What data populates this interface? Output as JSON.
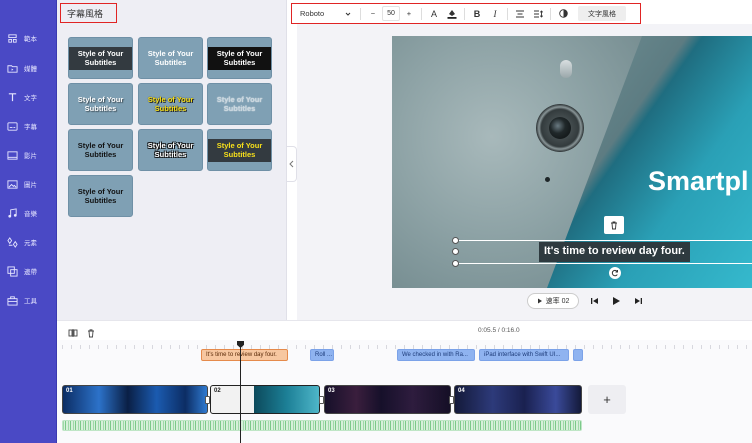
{
  "sidebar": {
    "items": [
      {
        "label": "範本",
        "icon": "template-icon"
      },
      {
        "label": "媒體",
        "icon": "media-icon"
      },
      {
        "label": "文字",
        "icon": "text-icon"
      },
      {
        "label": "字幕",
        "icon": "subtitle-icon"
      },
      {
        "label": "影片",
        "icon": "video-icon"
      },
      {
        "label": "圖片",
        "icon": "image-icon"
      },
      {
        "label": "音樂",
        "icon": "music-icon"
      },
      {
        "label": "元素",
        "icon": "elements-icon"
      },
      {
        "label": "邊帶",
        "icon": "overlay-icon"
      },
      {
        "label": "工具",
        "icon": "tools-icon"
      }
    ],
    "color": "#4a49c5"
  },
  "panel": {
    "title": "字幕風格",
    "styles": [
      {
        "text": "Style of Your Subtitles",
        "variant": "dark-box"
      },
      {
        "text": "Style of Your Subtitles",
        "variant": "plain"
      },
      {
        "text": "Style of Your Subtitles",
        "variant": "black-box"
      },
      {
        "text": "Style of Your Subtitles",
        "variant": "shadow"
      },
      {
        "text": "Style of Your Subtitles",
        "variant": "yellow-outline"
      },
      {
        "text": "Style of Your Subtitles",
        "variant": "faint"
      },
      {
        "text": "Style of Your Subtitles",
        "variant": "black-text"
      },
      {
        "text": "Style of Your Subtitles",
        "variant": "white-outline"
      },
      {
        "text": "Style of Your Subtitles",
        "variant": "yellow-on-dark"
      },
      {
        "text": "Style of Your Subtitles",
        "variant": "black-text"
      }
    ]
  },
  "toolbar": {
    "font": "Roboto",
    "minus": "−",
    "size": "50",
    "plus": "+",
    "text_color_glyph": "A",
    "bold": "B",
    "italic": "I",
    "style_button": "文字風格"
  },
  "preview": {
    "brand_text": "Smartpl",
    "subtitle": "It's time to review day four."
  },
  "playback": {
    "speed_label": "速率 02"
  },
  "timeline": {
    "timecode": "0:05.5 / 0:16.0",
    "captions": [
      "It's time to review day four.",
      "Roll ...",
      "We checked in with Ra...",
      "iPad interface with Swift UI...",
      ""
    ],
    "clips": [
      "01",
      "02",
      "03",
      "04"
    ],
    "add_label": "+"
  },
  "colors": {
    "accent_red": "#e02424",
    "caption_active": "#f7c7a0",
    "caption": "#8fb3f0"
  }
}
